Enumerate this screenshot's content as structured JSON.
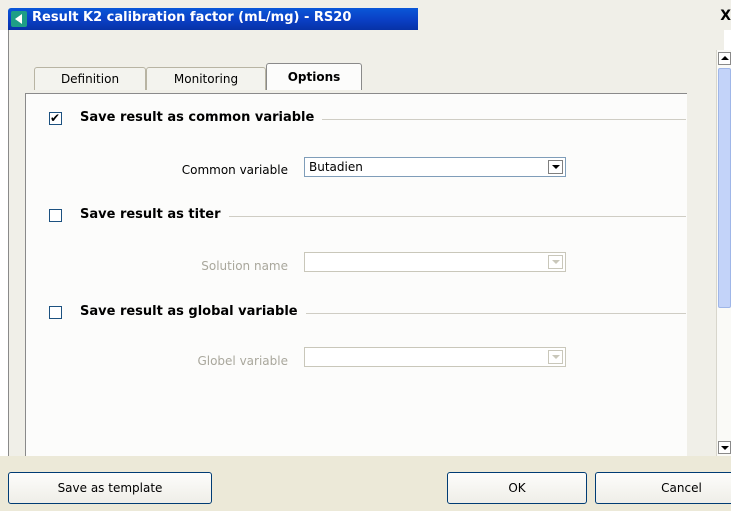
{
  "window": {
    "title": "Result K2 calibration factor (mL/mg) - RS20",
    "close_glyph": "X"
  },
  "tabs": [
    {
      "label": "Definition",
      "active": false
    },
    {
      "label": "Monitoring",
      "active": false
    },
    {
      "label": "Options",
      "active": true
    }
  ],
  "sections": {
    "common": {
      "label": "Save result as common variable",
      "checked": true,
      "field_label": "Common variable",
      "value": "Butadien",
      "enabled": true
    },
    "titer": {
      "label": "Save result as titer",
      "checked": false,
      "field_label": "Solution name",
      "value": "",
      "enabled": false
    },
    "global": {
      "label": "Save result as global variable",
      "checked": false,
      "field_label": "Globel variable",
      "value": "",
      "enabled": false
    }
  },
  "footer": {
    "save_template": "Save as template",
    "ok": "OK",
    "cancel": "Cancel"
  },
  "colors": {
    "titlebar": "#0a49d0",
    "accent_icon": "#1e9e86",
    "panel_bg": "#fcfcfb"
  },
  "icons": [
    "app-logo-icon",
    "close-icon",
    "checkbox-checked-icon",
    "dropdown-arrow-icon",
    "scroll-up-icon",
    "scroll-down-icon"
  ]
}
